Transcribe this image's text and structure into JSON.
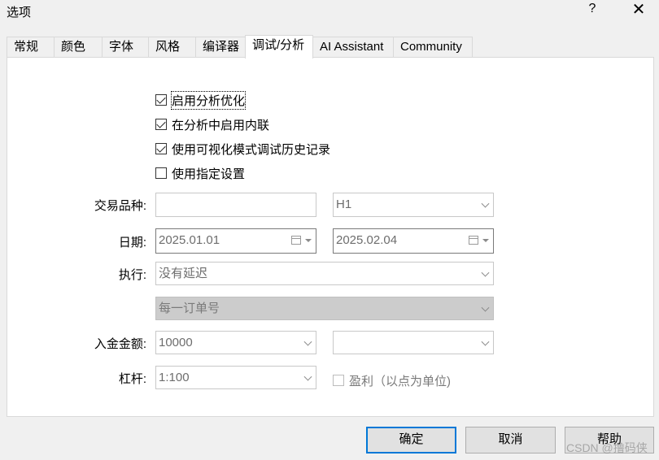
{
  "window": {
    "title": "选项",
    "help_glyph": "?",
    "close_glyph": "✕"
  },
  "tabs": [
    {
      "label": "常规"
    },
    {
      "label": "颜色"
    },
    {
      "label": "字体"
    },
    {
      "label": "风格"
    },
    {
      "label": "编译器"
    },
    {
      "label": "调试/分析",
      "active": true
    },
    {
      "label": "AI Assistant"
    },
    {
      "label": "Community"
    }
  ],
  "options": {
    "enable_profiling": {
      "label": "启用分析优化",
      "checked": true
    },
    "enable_inline": {
      "label": "在分析中启用内联",
      "checked": true
    },
    "visual_history": {
      "label": "使用可视化模式调试历史记录",
      "checked": true
    },
    "use_settings": {
      "label": "使用指定设置",
      "checked": false
    }
  },
  "form": {
    "symbol_label": "交易品种:",
    "symbol_value": "",
    "timeframe_value": "H1",
    "date_label": "日期:",
    "date_from": "2025.01.01",
    "date_to": "2025.02.04",
    "execution_label": "执行:",
    "execution_value": "没有延迟",
    "ticks_value": "每一订单号",
    "deposit_label": "入金金额:",
    "deposit_value": "10000",
    "currency_value": "",
    "leverage_label": "杠杆:",
    "leverage_value": "1:100",
    "profit_label": "盈利（以点为单位)",
    "profit_checked": false
  },
  "buttons": {
    "ok": "确定",
    "cancel": "取消",
    "help": "帮助"
  },
  "watermark": "CSDN @撸码侠"
}
